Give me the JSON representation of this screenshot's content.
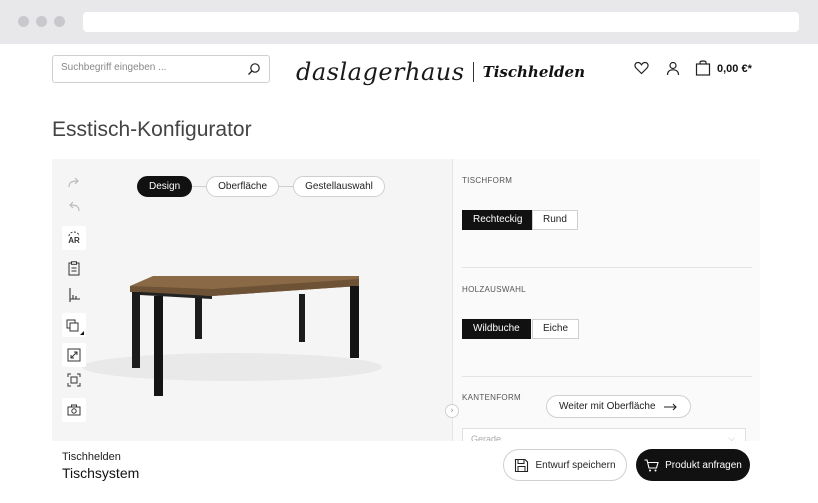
{
  "browser": {
    "url": ""
  },
  "header": {
    "search_placeholder": "Suchbegriff eingeben ...",
    "logo_script": "daslagerhaus",
    "logo_brand": "Tischhelden",
    "cart_total": "0,00 €*"
  },
  "page": {
    "title": "Esstisch-Konfigurator"
  },
  "viewer": {
    "tabs": [
      {
        "label": "Design",
        "active": true
      },
      {
        "label": "Oberfläche",
        "active": false
      },
      {
        "label": "Gestellauswahl",
        "active": false
      }
    ],
    "tools": [
      "redo-icon",
      "undo-icon",
      "ar-icon",
      "clipboard-icon",
      "measure-icon",
      "layers-icon",
      "fullscreen-icon",
      "fit-view-icon",
      "camera-icon"
    ],
    "ar_label": "AR"
  },
  "config": {
    "tischform": {
      "label": "TISCHFORM",
      "options": [
        "Rechteckig",
        "Rund"
      ],
      "selected": "Rechteckig"
    },
    "holzauswahl": {
      "label": "HOLZAUSWAHL",
      "options": [
        "Wildbuche",
        "Eiche"
      ],
      "selected": "Wildbuche"
    },
    "kantenform": {
      "label": "KANTENFORM",
      "select_value": "Gerade"
    },
    "next_button": "Weiter mit Oberfläche"
  },
  "footer": {
    "brand": "Tischhelden",
    "product": "Tischsystem",
    "save_label": "Entwurf speichern",
    "request_label": "Produkt anfragen"
  },
  "colors": {
    "accent": "#111111",
    "viewer_bg": "#f5f5f5",
    "wood": "#8a6a46"
  }
}
